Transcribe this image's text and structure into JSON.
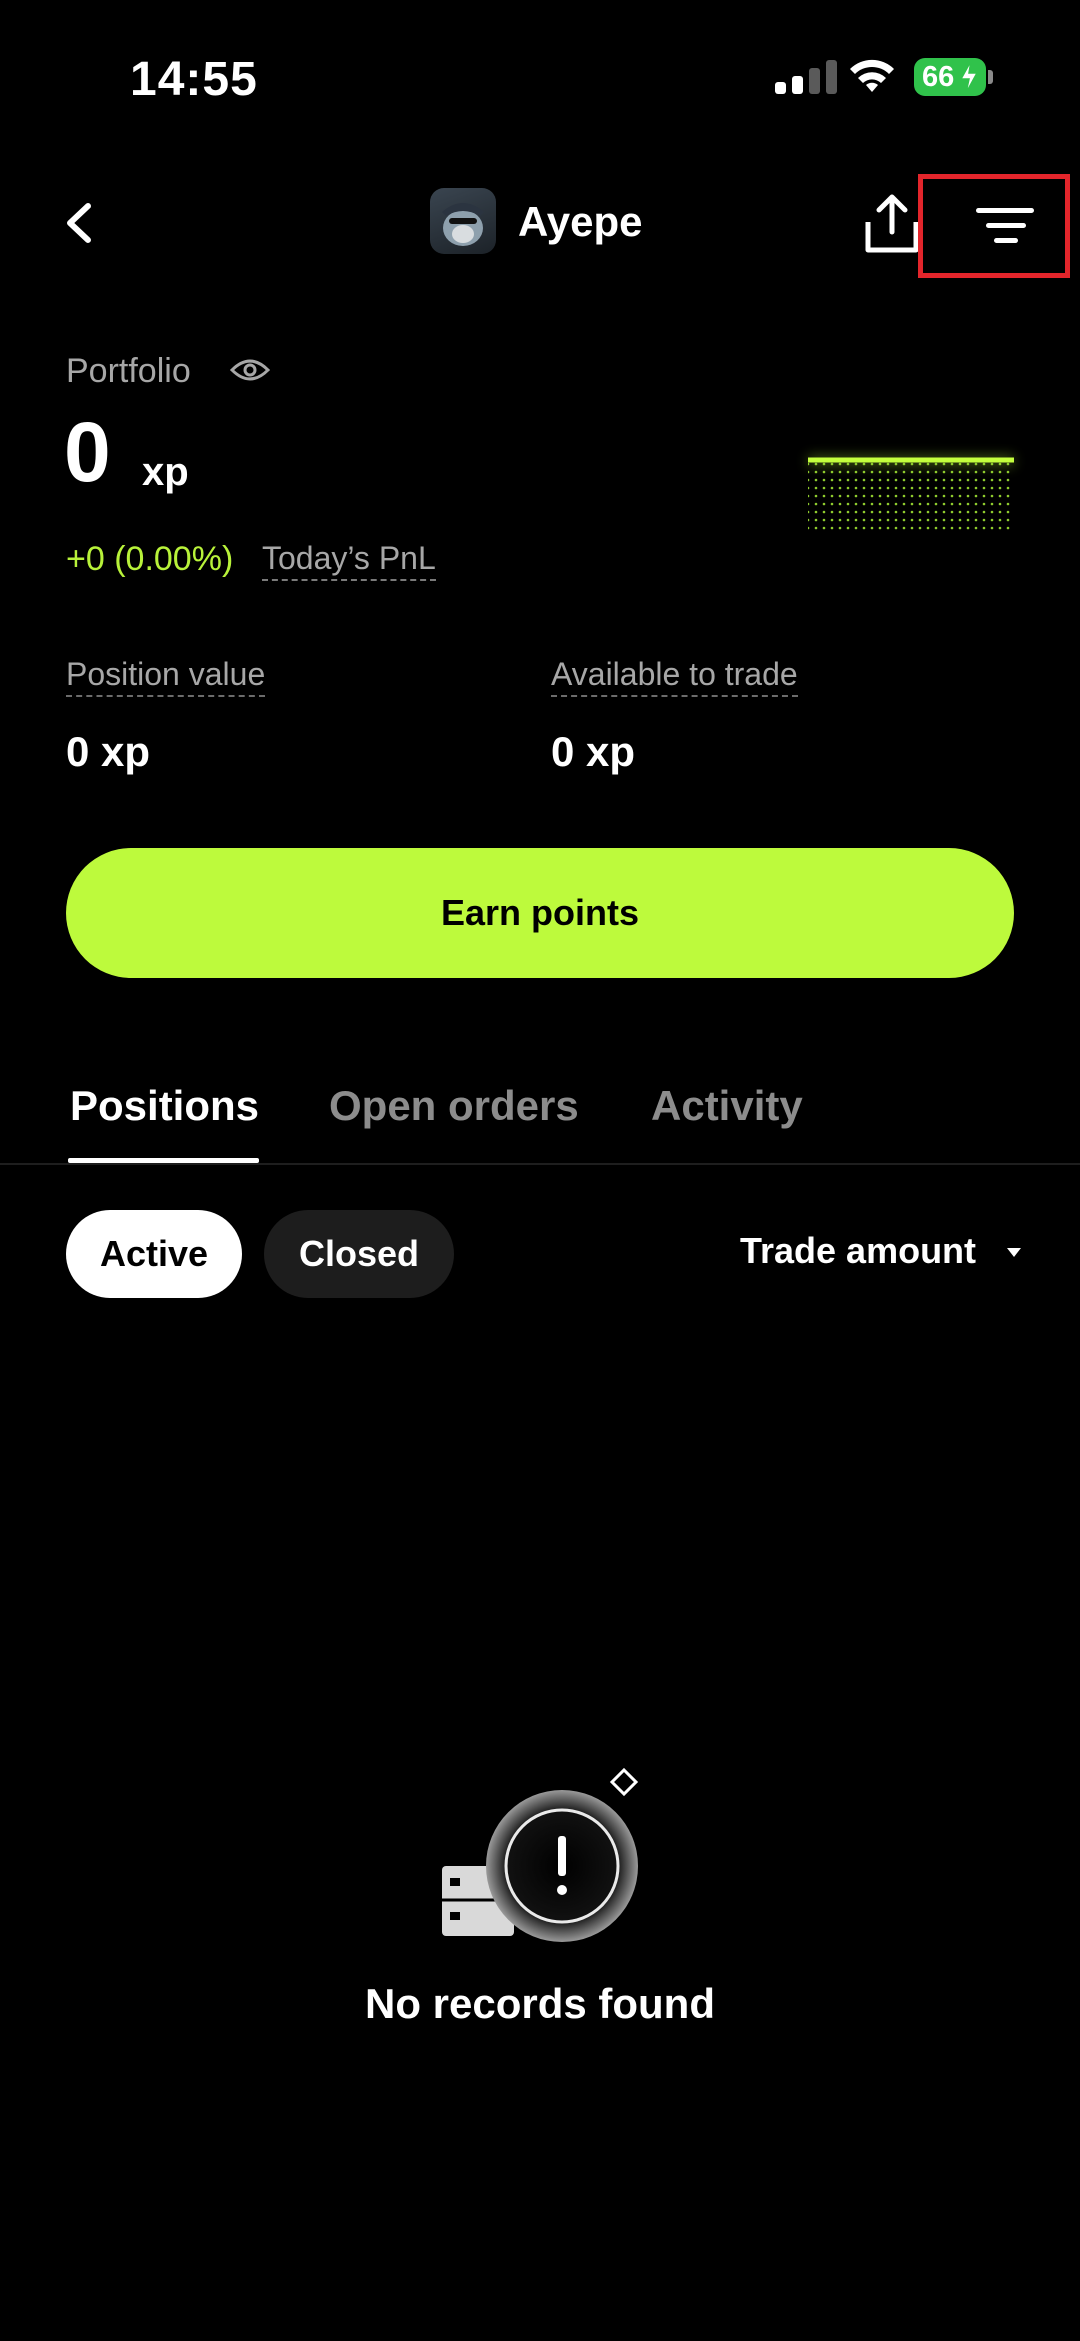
{
  "status_bar": {
    "time": "14:55",
    "battery": "66"
  },
  "header": {
    "username": "Ayepe"
  },
  "portfolio": {
    "label": "Portfolio",
    "value": "0",
    "unit": "xp",
    "pnl_change": "+0 (0.00%)",
    "pnl_label": "Today’s PnL",
    "position_value_label": "Position value",
    "position_value": "0 xp",
    "available_label": "Available to trade",
    "available_value": "0 xp"
  },
  "cta": {
    "earn_label": "Earn points"
  },
  "tabs": [
    {
      "label": "Positions",
      "active": true
    },
    {
      "label": "Open orders",
      "active": false
    },
    {
      "label": "Activity",
      "active": false
    }
  ],
  "filters": {
    "active_label": "Active",
    "closed_label": "Closed",
    "sort_label": "Trade amount"
  },
  "empty_state": {
    "message": "No records found"
  },
  "colors": {
    "accent": "#bdfa3c",
    "pnl": "#b8f23a",
    "highlight_box": "#e3252b",
    "battery": "#30c24b"
  }
}
